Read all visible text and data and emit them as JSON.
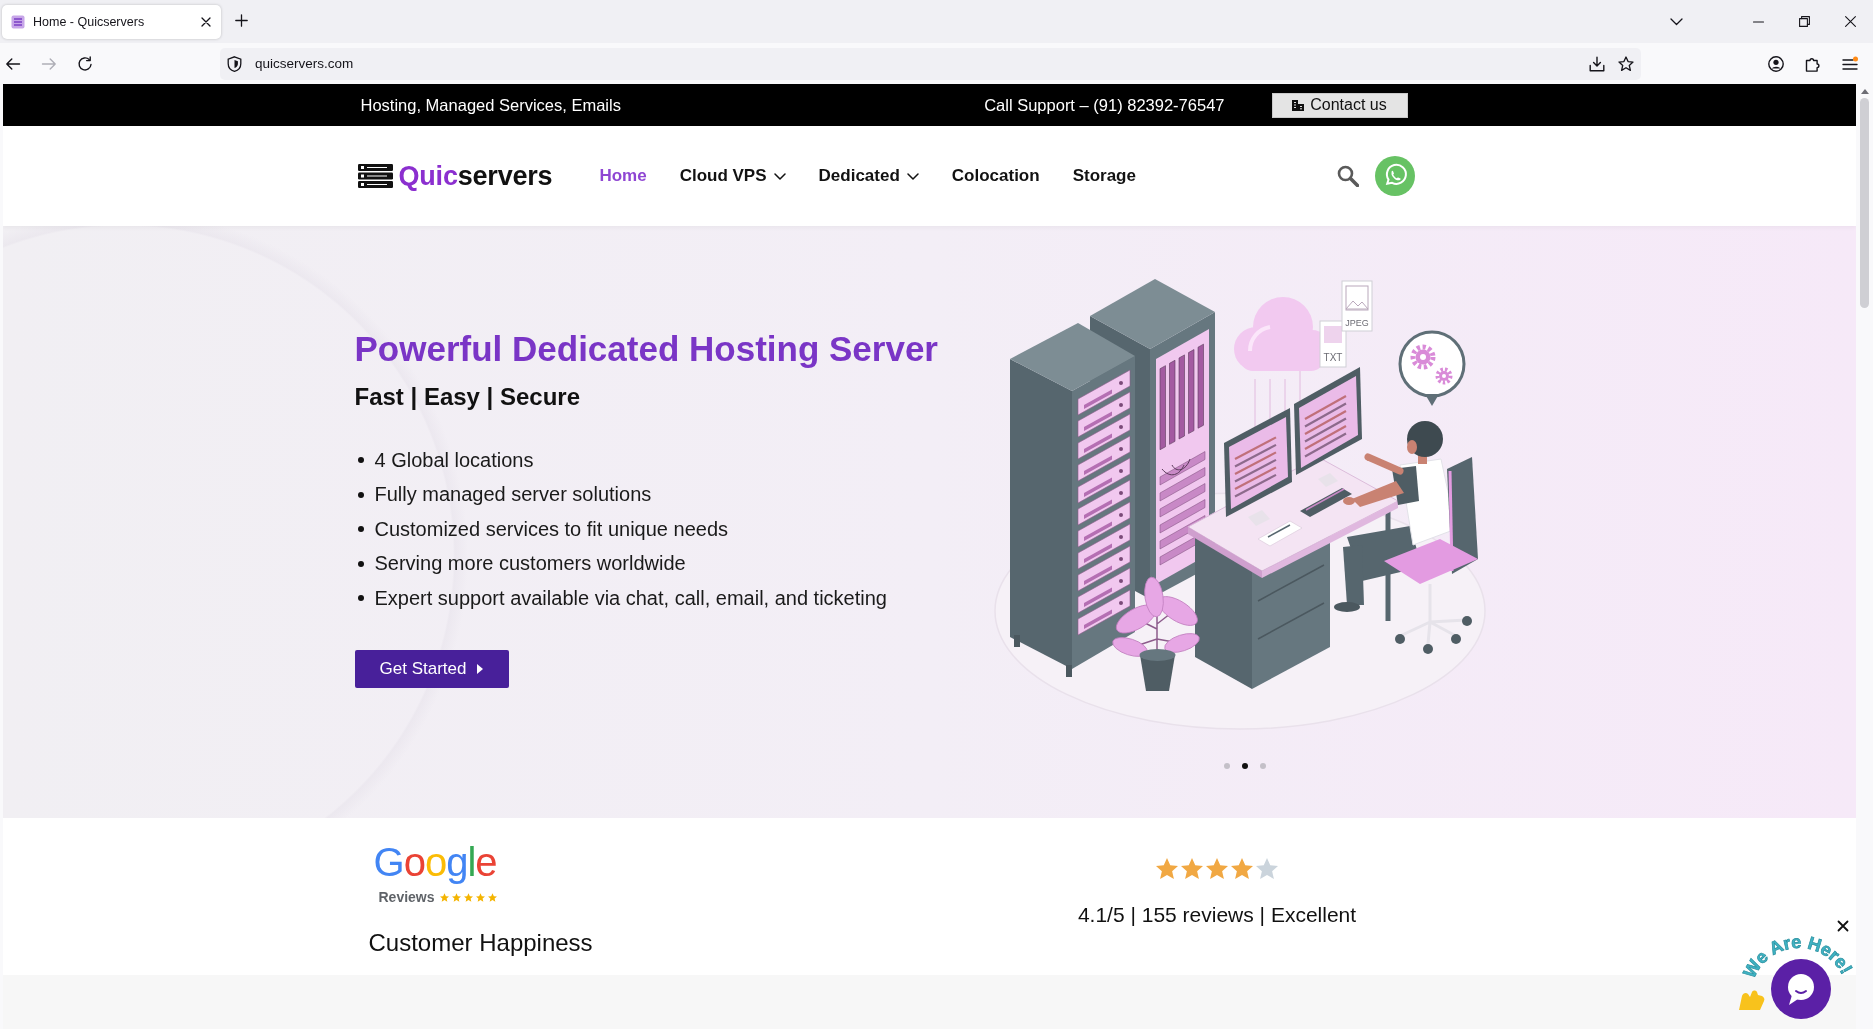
{
  "browser": {
    "tab": {
      "title": "Home - Quicservers",
      "selected": true
    },
    "nav_buttons": [
      {
        "kind": "back",
        "disabled": false
      },
      {
        "kind": "forward",
        "disabled": true
      },
      {
        "kind": "reload",
        "disabled": false
      }
    ],
    "url": "quicservers.com"
  },
  "top_bar": {
    "tagline": "Hosting, Managed Services, Emails",
    "support": "Call Support – (91) 82392-76547",
    "contact_button": "Contact us"
  },
  "header": {
    "logo": {
      "accent": "Quic",
      "rest": "servers"
    },
    "nav": [
      {
        "label": "Home",
        "selected": true,
        "has_menu": false
      },
      {
        "label": "Cloud VPS",
        "selected": false,
        "has_menu": true
      },
      {
        "label": "Dedicated",
        "selected": false,
        "has_menu": true
      },
      {
        "label": "Colocation",
        "selected": false,
        "has_menu": false
      },
      {
        "label": "Storage",
        "selected": false,
        "has_menu": false
      }
    ]
  },
  "hero": {
    "title": "Powerful Dedicated Hosting Server",
    "subtitle": "Fast | Easy | Secure",
    "bullets": [
      "4 Global locations",
      "Fully managed server solutions",
      "Customized services to fit unique needs",
      "Serving more customers worldwide",
      "Expert support available via chat, call, email, and ticketing"
    ],
    "button": "Get Started",
    "file_labels": [
      "TXT",
      "JPEG"
    ],
    "slides": [
      {
        "selected": false
      },
      {
        "selected": true
      },
      {
        "selected": false
      }
    ]
  },
  "reviews": {
    "brand": "Google",
    "brand_sub": "Reviews",
    "heading": "Customer Happiness",
    "stars": 4,
    "summary": "4.1/5 | 155 reviews | Excellent"
  },
  "chat_widget": {
    "label": "We Are Here!"
  }
}
